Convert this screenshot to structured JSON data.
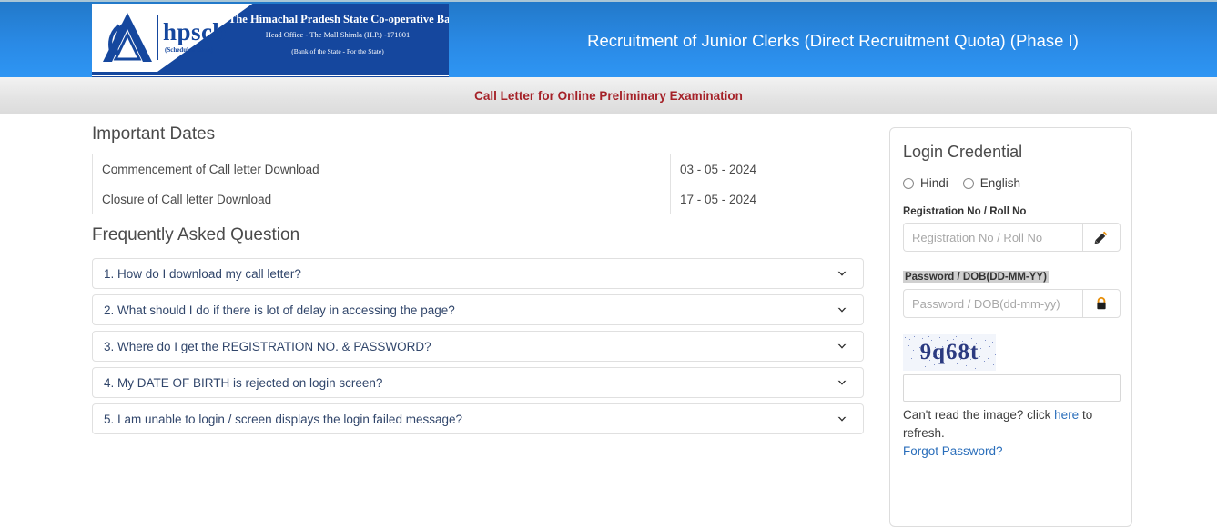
{
  "header": {
    "title": "Recruitment of Junior Clerks (Direct Recruitment Quota) (Phase I)",
    "logo": {
      "wordmark": "hpscb",
      "wordmark_sub": "(Scheduled Bank)",
      "bank_name": "The Himachal Pradesh State Co-operative Bank Ltd.",
      "bank_address": "Head Office - The Mall Shimla (H.P.) -171001",
      "bank_tagline": "(Bank of the State - For the State)"
    },
    "brand_blue": "#15479e",
    "header_gradient_top": "#2279c9",
    "header_gradient_bottom": "#2e96f4"
  },
  "subtitle": {
    "text": "Call Letter for Online Preliminary Examination",
    "color": "#a52128"
  },
  "important_dates": {
    "heading": "Important Dates",
    "rows": [
      {
        "label": "Commencement of Call letter Download",
        "value": "03 - 05 - 2024"
      },
      {
        "label": "Closure of Call letter Download",
        "value": "17 - 05 - 2024"
      }
    ]
  },
  "faq": {
    "heading": "Frequently Asked Question",
    "items": [
      {
        "question": "1. How do I download my call letter?"
      },
      {
        "question": "2. What should I do if there is lot of delay in accessing the page?"
      },
      {
        "question": "3. Where do I get the REGISTRATION NO. & PASSWORD?"
      },
      {
        "question": "4. My DATE OF BIRTH is rejected on login screen?"
      },
      {
        "question": "5. I am unable to login / screen displays the login failed message?"
      }
    ]
  },
  "login": {
    "heading": "Login Credential",
    "languages": [
      {
        "label": "Hindi",
        "selected": false
      },
      {
        "label": "English",
        "selected": false
      }
    ],
    "registration": {
      "label": "Registration No / Roll No",
      "placeholder": "Registration No / Roll No",
      "value": ""
    },
    "password": {
      "label": "Password / DOB(DD-MM-YY)",
      "placeholder": "Password / DOB(dd-mm-yy)",
      "value": "",
      "label_highlighted": true
    },
    "captcha": {
      "text": "9q68t",
      "input_value": "",
      "hint_before": "Can't read the image? click ",
      "hint_link": "here",
      "hint_after": " to refresh."
    },
    "forgot_password": "Forgot Password?",
    "link_color": "#2a6ebb"
  }
}
